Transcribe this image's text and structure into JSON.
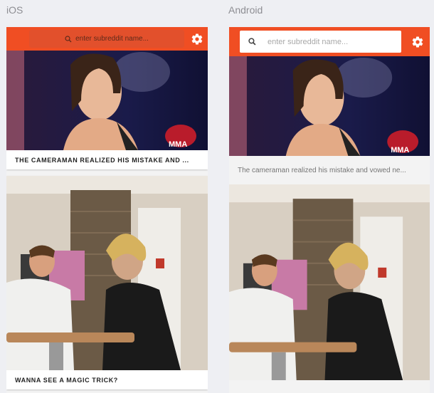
{
  "labels": {
    "ios": "iOS",
    "android": "Android"
  },
  "colors": {
    "accent": "#f04e23",
    "search_ios_bg": "#e2502c",
    "background": "#eeeff3"
  },
  "ios": {
    "search": {
      "placeholder": "enter subreddit name...",
      "icon": "search-icon"
    },
    "settings_icon": "gear-icon",
    "posts": [
      {
        "title": "THE CAMERAMAN REALIZED HIS MISTAKE AND ..."
      },
      {
        "title": "WANNA SEE A MAGIC TRICK?"
      }
    ]
  },
  "android": {
    "search": {
      "placeholder": "enter subreddit name...",
      "icon": "search-icon"
    },
    "settings_icon": "gear-icon",
    "posts": [
      {
        "title": "The cameraman realized his mistake and vowed ne..."
      },
      {
        "title": ""
      }
    ]
  },
  "image_watermark": "MMA"
}
